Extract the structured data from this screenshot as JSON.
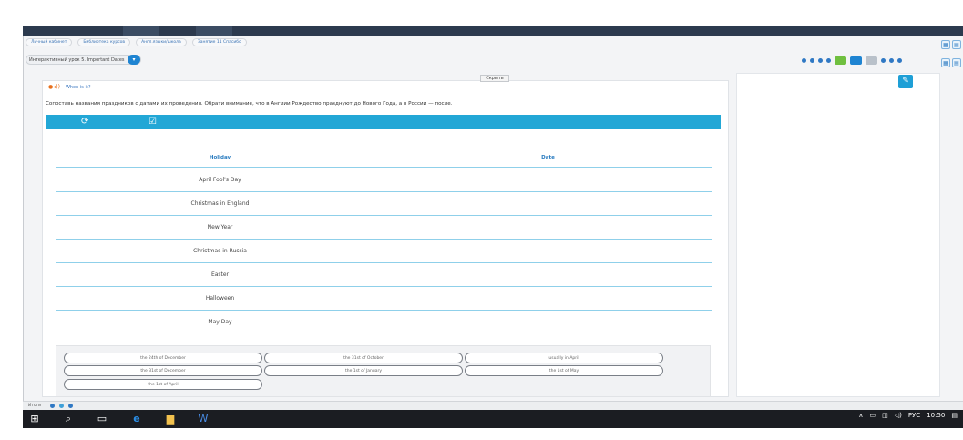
{
  "breadcrumbs": [
    "Личный кабинет",
    "Библиотека курсов",
    "Англ.языки/школа",
    "Занятие 11 Cпасибо"
  ],
  "lesson_select": {
    "value": "Интерактивный урок 5. Important Dates"
  },
  "hide_button": "Скрыть",
  "task": {
    "title": "When is it?",
    "instruction": "Сопоставь названия праздников с датами их проведения. Обрати внимание, что в Англии Рождество празднуют до Нового Года, а в России — после."
  },
  "toolbar": {
    "reset_icon": "refresh-icon",
    "check_icon": "check-icon"
  },
  "table": {
    "headers": [
      "Holiday",
      "Date"
    ],
    "rows": [
      {
        "holiday": "April Fool's Day",
        "date": ""
      },
      {
        "holiday": "Christmas in England",
        "date": ""
      },
      {
        "holiday": "New Year",
        "date": ""
      },
      {
        "holiday": "Christmas in Russia",
        "date": ""
      },
      {
        "holiday": "Easter",
        "date": ""
      },
      {
        "holiday": "Halloween",
        "date": ""
      },
      {
        "holiday": "May Day",
        "date": ""
      }
    ]
  },
  "answer_bank": [
    "the 24th of December",
    "the 31st of October",
    "usually in April",
    "the 31st of December",
    "the 1st of January",
    "the 1st of May",
    "the 1st of April"
  ],
  "status_strip": {
    "label": "Итоги"
  },
  "tray": {
    "language": "РУС",
    "time": "10:50"
  },
  "colors": {
    "accent": "#22a7d6",
    "header": "#2c3a4e",
    "taskbar": "#1b1d22",
    "table_border": "#8fd0ea"
  }
}
